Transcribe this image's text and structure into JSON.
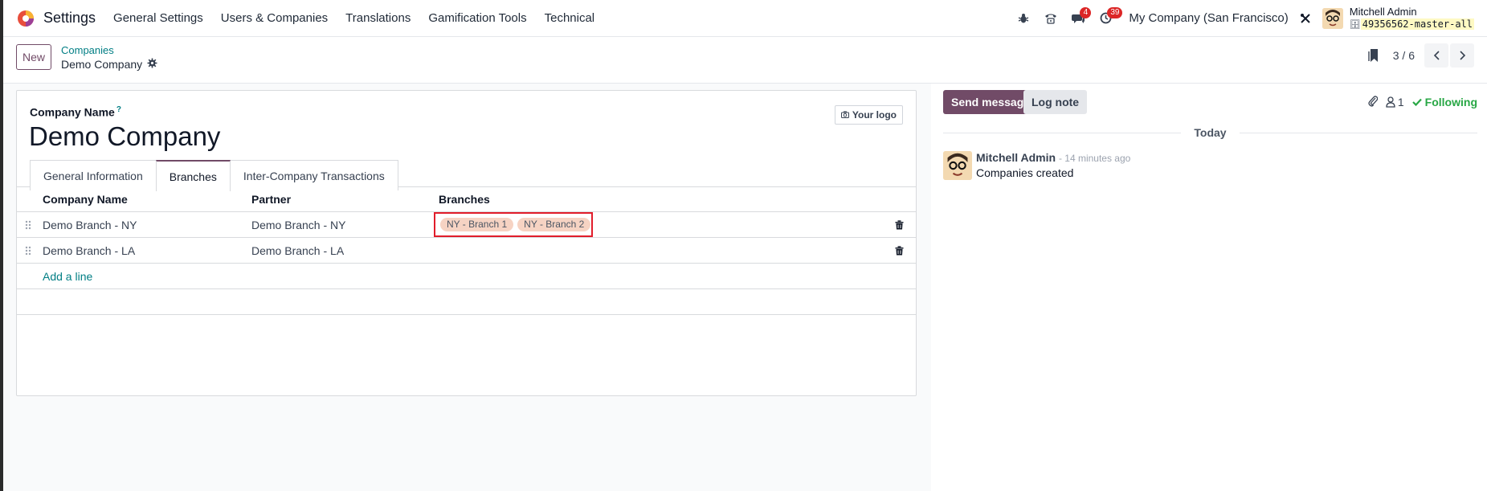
{
  "navbar": {
    "app_name": "Settings",
    "menu": [
      "General Settings",
      "Users & Companies",
      "Translations",
      "Gamification Tools",
      "Technical"
    ],
    "messages_badge": "4",
    "activities_badge": "39",
    "company": "My Company (San Francisco)",
    "user_name": "Mitchell Admin",
    "db_name": "49356562-master-all"
  },
  "control": {
    "new_label": "New",
    "breadcrumb": "Companies",
    "record_title": "Demo Company",
    "pager": "3 / 6"
  },
  "form": {
    "field_label": "Company Name",
    "help_mark": "?",
    "company_name": "Demo Company",
    "logo_label": "Your logo",
    "tabs": [
      "General Information",
      "Branches",
      "Inter-Company Transactions"
    ],
    "active_tab": "Branches",
    "columns": [
      "Company Name",
      "Partner",
      "Branches"
    ],
    "rows": [
      {
        "name": "Demo Branch - NY",
        "partner": "Demo Branch - NY",
        "branches": [
          "NY - Branch 1",
          "NY - Branch 2"
        ]
      },
      {
        "name": "Demo Branch - LA",
        "partner": "Demo Branch - LA",
        "branches": []
      }
    ],
    "add_line": "Add a line"
  },
  "chatter": {
    "send_message": "Send message",
    "log_note": "Log note",
    "followers_count": "1",
    "following": "Following",
    "date_label": "Today",
    "messages": [
      {
        "author": "Mitchell Admin",
        "time": "- 14 minutes ago",
        "text": "Companies created"
      }
    ]
  },
  "colors": {
    "brand": "#714b67",
    "link": "#017e84",
    "badge": "#dc2626",
    "tag": "#f6d3c3",
    "highlight": "#e11d2b",
    "following": "#28a745"
  }
}
